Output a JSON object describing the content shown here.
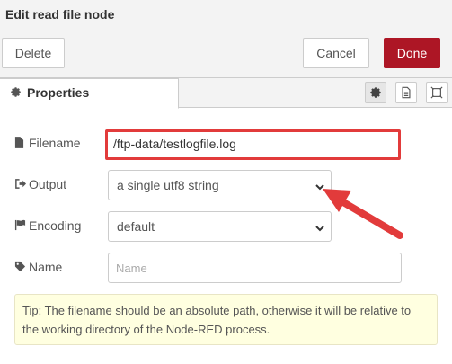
{
  "dialog": {
    "title": "Edit read file node"
  },
  "toolbar": {
    "delete_label": "Delete",
    "cancel_label": "Cancel",
    "done_label": "Done"
  },
  "tabs": {
    "properties_label": "Properties",
    "icons": [
      "gear-icon",
      "document-icon",
      "frame-icon"
    ]
  },
  "form": {
    "filename": {
      "label": "Filename",
      "value": "/ftp-data/testlogfile.log"
    },
    "output": {
      "label": "Output",
      "value": "a single utf8 string"
    },
    "encoding": {
      "label": "Encoding",
      "value": "default"
    },
    "name": {
      "label": "Name",
      "value": "",
      "placeholder": "Name"
    }
  },
  "tip": {
    "text": "Tip: The filename should be an absolute path, otherwise it will be relative to the working directory of the Node-RED process."
  },
  "colors": {
    "accent": "#ad1625",
    "highlight": "#e23b3b",
    "tip_bg": "#ffffe0"
  }
}
